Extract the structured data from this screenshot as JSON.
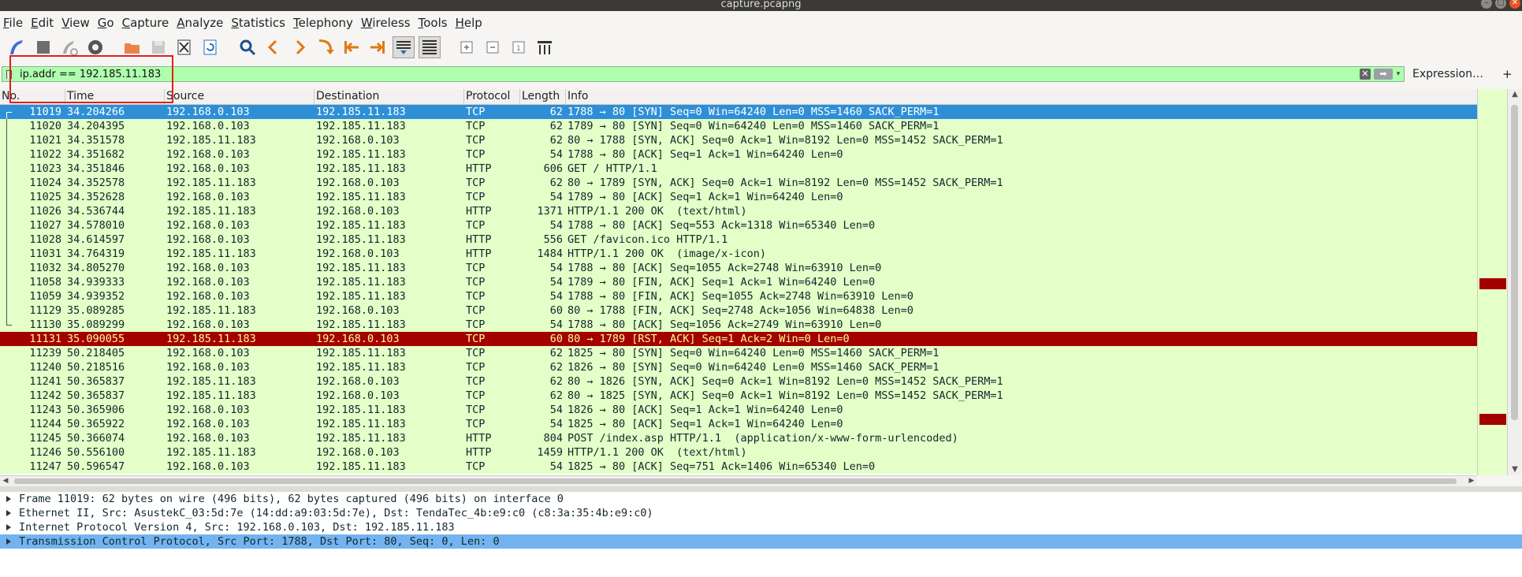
{
  "window": {
    "title": "capture.pcapng"
  },
  "menu": [
    "File",
    "Edit",
    "View",
    "Go",
    "Capture",
    "Analyze",
    "Statistics",
    "Telephony",
    "Wireless",
    "Tools",
    "Help"
  ],
  "toolbar": {
    "icons": [
      "start-capture-icon",
      "stop-capture-icon",
      "restart-capture-icon",
      "capture-options-icon",
      "open-file-icon",
      "save-file-icon",
      "close-file-icon",
      "reload-file-icon",
      "find-packet-icon",
      "go-back-icon",
      "go-forward-icon",
      "go-to-packet-icon",
      "go-first-icon",
      "go-last-icon",
      "autoscroll-icon",
      "colorize-icon",
      "zoom-in-icon",
      "zoom-out-icon",
      "normal-size-icon",
      "resize-columns-icon"
    ]
  },
  "filter": {
    "value": "ip.addr == 192.185.11.183",
    "expression_label": "Expression…",
    "add_label": "+",
    "clear_glyph": "✕",
    "apply_glyph": "➡",
    "dropdown_glyph": "▾"
  },
  "columns": {
    "no": "No.",
    "time": "Time",
    "source": "Source",
    "destination": "Destination",
    "protocol": "Protocol",
    "length": "Length",
    "info": "Info"
  },
  "packets": [
    {
      "no": "11019",
      "time": "34.204266",
      "src": "192.168.0.103",
      "dst": "192.185.11.183",
      "proto": "TCP",
      "len": "62",
      "info": "1788 → 80 [SYN] Seq=0 Win=64240 Len=0 MSS=1460 SACK_PERM=1",
      "state": "selected",
      "bracket": "start"
    },
    {
      "no": "11020",
      "time": "34.204395",
      "src": "192.168.0.103",
      "dst": "192.185.11.183",
      "proto": "TCP",
      "len": "62",
      "info": "1789 → 80 [SYN] Seq=0 Win=64240 Len=0 MSS=1460 SACK_PERM=1",
      "state": "",
      "bracket": "mid"
    },
    {
      "no": "11021",
      "time": "34.351578",
      "src": "192.185.11.183",
      "dst": "192.168.0.103",
      "proto": "TCP",
      "len": "62",
      "info": "80 → 1788 [SYN, ACK] Seq=0 Ack=1 Win=8192 Len=0 MSS=1452 SACK_PERM=1",
      "state": "",
      "bracket": "mid"
    },
    {
      "no": "11022",
      "time": "34.351682",
      "src": "192.168.0.103",
      "dst": "192.185.11.183",
      "proto": "TCP",
      "len": "54",
      "info": "1788 → 80 [ACK] Seq=1 Ack=1 Win=64240 Len=0",
      "state": "",
      "bracket": "mid"
    },
    {
      "no": "11023",
      "time": "34.351846",
      "src": "192.168.0.103",
      "dst": "192.185.11.183",
      "proto": "HTTP",
      "len": "606",
      "info": "GET / HTTP/1.1",
      "state": "",
      "bracket": "mid"
    },
    {
      "no": "11024",
      "time": "34.352578",
      "src": "192.185.11.183",
      "dst": "192.168.0.103",
      "proto": "TCP",
      "len": "62",
      "info": "80 → 1789 [SYN, ACK] Seq=0 Ack=1 Win=8192 Len=0 MSS=1452 SACK_PERM=1",
      "state": "",
      "bracket": "mid"
    },
    {
      "no": "11025",
      "time": "34.352628",
      "src": "192.168.0.103",
      "dst": "192.185.11.183",
      "proto": "TCP",
      "len": "54",
      "info": "1789 → 80 [ACK] Seq=1 Ack=1 Win=64240 Len=0",
      "state": "",
      "bracket": "mid"
    },
    {
      "no": "11026",
      "time": "34.536744",
      "src": "192.185.11.183",
      "dst": "192.168.0.103",
      "proto": "HTTP",
      "len": "1371",
      "info": "HTTP/1.1 200 OK  (text/html)",
      "state": "",
      "bracket": "mid"
    },
    {
      "no": "11027",
      "time": "34.578010",
      "src": "192.168.0.103",
      "dst": "192.185.11.183",
      "proto": "TCP",
      "len": "54",
      "info": "1788 → 80 [ACK] Seq=553 Ack=1318 Win=65340 Len=0",
      "state": "",
      "bracket": "mid"
    },
    {
      "no": "11028",
      "time": "34.614597",
      "src": "192.168.0.103",
      "dst": "192.185.11.183",
      "proto": "HTTP",
      "len": "556",
      "info": "GET /favicon.ico HTTP/1.1",
      "state": "",
      "bracket": "mid"
    },
    {
      "no": "11031",
      "time": "34.764319",
      "src": "192.185.11.183",
      "dst": "192.168.0.103",
      "proto": "HTTP",
      "len": "1484",
      "info": "HTTP/1.1 200 OK  (image/x-icon)",
      "state": "",
      "bracket": "mid"
    },
    {
      "no": "11032",
      "time": "34.805270",
      "src": "192.168.0.103",
      "dst": "192.185.11.183",
      "proto": "TCP",
      "len": "54",
      "info": "1788 → 80 [ACK] Seq=1055 Ack=2748 Win=63910 Len=0",
      "state": "",
      "bracket": "mid"
    },
    {
      "no": "11058",
      "time": "34.939333",
      "src": "192.168.0.103",
      "dst": "192.185.11.183",
      "proto": "TCP",
      "len": "54",
      "info": "1789 → 80 [FIN, ACK] Seq=1 Ack=1 Win=64240 Len=0",
      "state": "",
      "bracket": "mid"
    },
    {
      "no": "11059",
      "time": "34.939352",
      "src": "192.168.0.103",
      "dst": "192.185.11.183",
      "proto": "TCP",
      "len": "54",
      "info": "1788 → 80 [FIN, ACK] Seq=1055 Ack=2748 Win=63910 Len=0",
      "state": "",
      "bracket": "mid"
    },
    {
      "no": "11129",
      "time": "35.089285",
      "src": "192.185.11.183",
      "dst": "192.168.0.103",
      "proto": "TCP",
      "len": "60",
      "info": "80 → 1788 [FIN, ACK] Seq=2748 Ack=1056 Win=64838 Len=0",
      "state": "",
      "bracket": "mid"
    },
    {
      "no": "11130",
      "time": "35.089299",
      "src": "192.168.0.103",
      "dst": "192.185.11.183",
      "proto": "TCP",
      "len": "54",
      "info": "1788 → 80 [ACK] Seq=1056 Ack=2749 Win=63910 Len=0",
      "state": "",
      "bracket": "end"
    },
    {
      "no": "11131",
      "time": "35.090055",
      "src": "192.185.11.183",
      "dst": "192.168.0.103",
      "proto": "TCP",
      "len": "60",
      "info": "80 → 1789 [RST, ACK] Seq=1 Ack=2 Win=0 Len=0",
      "state": "rst",
      "bracket": ""
    },
    {
      "no": "11239",
      "time": "50.218405",
      "src": "192.168.0.103",
      "dst": "192.185.11.183",
      "proto": "TCP",
      "len": "62",
      "info": "1825 → 80 [SYN] Seq=0 Win=64240 Len=0 MSS=1460 SACK_PERM=1",
      "state": "",
      "bracket": ""
    },
    {
      "no": "11240",
      "time": "50.218516",
      "src": "192.168.0.103",
      "dst": "192.185.11.183",
      "proto": "TCP",
      "len": "62",
      "info": "1826 → 80 [SYN] Seq=0 Win=64240 Len=0 MSS=1460 SACK_PERM=1",
      "state": "",
      "bracket": ""
    },
    {
      "no": "11241",
      "time": "50.365837",
      "src": "192.185.11.183",
      "dst": "192.168.0.103",
      "proto": "TCP",
      "len": "62",
      "info": "80 → 1826 [SYN, ACK] Seq=0 Ack=1 Win=8192 Len=0 MSS=1452 SACK_PERM=1",
      "state": "",
      "bracket": ""
    },
    {
      "no": "11242",
      "time": "50.365837",
      "src": "192.185.11.183",
      "dst": "192.168.0.103",
      "proto": "TCP",
      "len": "62",
      "info": "80 → 1825 [SYN, ACK] Seq=0 Ack=1 Win=8192 Len=0 MSS=1452 SACK_PERM=1",
      "state": "",
      "bracket": ""
    },
    {
      "no": "11243",
      "time": "50.365906",
      "src": "192.168.0.103",
      "dst": "192.185.11.183",
      "proto": "TCP",
      "len": "54",
      "info": "1826 → 80 [ACK] Seq=1 Ack=1 Win=64240 Len=0",
      "state": "",
      "bracket": ""
    },
    {
      "no": "11244",
      "time": "50.365922",
      "src": "192.168.0.103",
      "dst": "192.185.11.183",
      "proto": "TCP",
      "len": "54",
      "info": "1825 → 80 [ACK] Seq=1 Ack=1 Win=64240 Len=0",
      "state": "",
      "bracket": ""
    },
    {
      "no": "11245",
      "time": "50.366074",
      "src": "192.168.0.103",
      "dst": "192.185.11.183",
      "proto": "HTTP",
      "len": "804",
      "info": "POST /index.asp HTTP/1.1  (application/x-www-form-urlencoded)",
      "state": "",
      "bracket": ""
    },
    {
      "no": "11246",
      "time": "50.556100",
      "src": "192.185.11.183",
      "dst": "192.168.0.103",
      "proto": "HTTP",
      "len": "1459",
      "info": "HTTP/1.1 200 OK  (text/html)",
      "state": "",
      "bracket": ""
    },
    {
      "no": "11247",
      "time": "50.596547",
      "src": "192.168.0.103",
      "dst": "192.185.11.183",
      "proto": "TCP",
      "len": "54",
      "info": "1825 → 80 [ACK] Seq=751 Ack=1406 Win=65340 Len=0",
      "state": "",
      "bracket": ""
    }
  ],
  "details": [
    {
      "text": "Frame 11019: 62 bytes on wire (496 bits), 62 bytes captured (496 bits) on interface 0",
      "selected": false
    },
    {
      "text": "Ethernet II, Src: AsustekC_03:5d:7e (14:dd:a9:03:5d:7e), Dst: TendaTec_4b:e9:c0 (c8:3a:35:4b:e9:c0)",
      "selected": false
    },
    {
      "text": "Internet Protocol Version 4, Src: 192.168.0.103, Dst: 192.185.11.183",
      "selected": false
    },
    {
      "text": "Transmission Control Protocol, Src Port: 1788, Dst Port: 80, Seq: 0, Len: 0",
      "selected": true
    }
  ],
  "colors": {
    "selected_row": "#2e8fd6",
    "rst_row_bg": "#a40000",
    "rst_row_fg": "#fffc9c",
    "tcp_row": "#e4ffc7",
    "filter_valid": "#afffaf",
    "highlight_box": "#e0201b"
  }
}
